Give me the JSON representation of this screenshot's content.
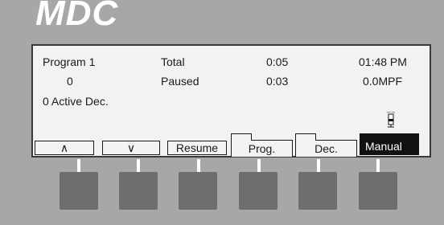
{
  "brand": "MDC",
  "display": {
    "row1": {
      "program": "Program  1",
      "total_label": "Total",
      "total_time": "0:05",
      "clock": "01:48  PM"
    },
    "row2": {
      "count": "0",
      "status": "Paused",
      "paused_time": "0:03",
      "rate": "0.0MPF"
    },
    "row3": {
      "active": "0 Active Dec."
    }
  },
  "softkeys": [
    {
      "label": "∧"
    },
    {
      "label": "∨"
    },
    {
      "label": "Resume"
    },
    {
      "label": "Prog."
    },
    {
      "label": "Dec."
    },
    {
      "label": "Manual"
    }
  ],
  "icons": {
    "status": "tower-lamp-icon"
  },
  "colors": {
    "panel": "#a7a7a9",
    "screen": "#f2f2f2",
    "button": "#6e6e70",
    "active_tab": "#111111"
  }
}
